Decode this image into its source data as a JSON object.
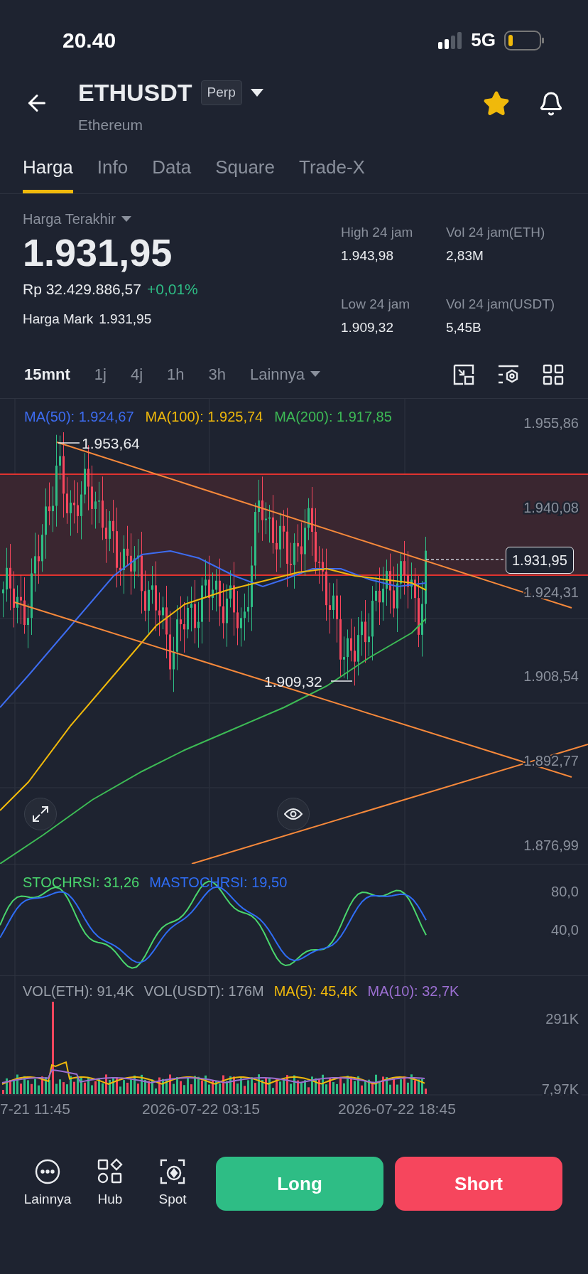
{
  "status_bar": {
    "time": "20.40",
    "network": "5G"
  },
  "header": {
    "symbol": "ETHUSDT",
    "badge": "Perp",
    "name": "Ethereum",
    "favorite": true
  },
  "tabs": [
    {
      "label": "Harga",
      "selected": true
    },
    {
      "label": "Info",
      "selected": false
    },
    {
      "label": "Data",
      "selected": false
    },
    {
      "label": "Square",
      "selected": false
    },
    {
      "label": "Trade-X",
      "selected": false
    }
  ],
  "stats": {
    "last_label": "Harga Terakhir",
    "price": "1.931,95",
    "fiat": "Rp 32.429.886,57",
    "change": "+0,01%",
    "mark_label": "Harga Mark",
    "mark_value": "1.931,95",
    "items": [
      {
        "label": "High 24 jam",
        "value": "1.943,98"
      },
      {
        "label": "Vol 24 jam(ETH)",
        "value": "2,83M"
      },
      {
        "label": "Low 24 jam",
        "value": "1.909,32"
      },
      {
        "label": "Vol 24 jam(USDT)",
        "value": "5,45B"
      }
    ]
  },
  "intervals": [
    {
      "label": "15mnt",
      "selected": true
    },
    {
      "label": "1j",
      "selected": false
    },
    {
      "label": "4j",
      "selected": false
    },
    {
      "label": "1h",
      "selected": false
    },
    {
      "label": "3h",
      "selected": false
    }
  ],
  "more_label": "Lainnya",
  "chart": {
    "legend": [
      {
        "label": "MA(50): 1.924,67",
        "color": "#3d6cf0"
      },
      {
        "label": "MA(100): 1.925,74",
        "color": "#f0b90b"
      },
      {
        "label": "MA(200): 1.917,85",
        "color": "#3dbb55"
      }
    ],
    "price_axis": [
      "1.955,86",
      "1.940,08",
      "1.924,31",
      "1.908,54",
      "1.892,77",
      "1.876,99"
    ],
    "high_marker": "1.953,64",
    "low_marker": "1.909,32",
    "current_price": "1.931,95"
  },
  "stoch": {
    "legend": [
      {
        "label": "STOCHRSI: 31,26",
        "color": "#4ad66d"
      },
      {
        "label": "MASTOCHRSI: 19,50",
        "color": "#2f6df5"
      }
    ],
    "axis": [
      "80,0",
      "40,0"
    ]
  },
  "volume": {
    "legend": [
      {
        "label": "VOL(ETH): 91,4K",
        "color": "#9aa0aa"
      },
      {
        "label": "VOL(USDT): 176M",
        "color": "#9aa0aa"
      },
      {
        "label": "MA(5): 45,4K",
        "color": "#f0b90b"
      },
      {
        "label": "MA(10): 32,7K",
        "color": "#9b6fd1"
      }
    ],
    "axis": [
      "291K",
      "7,97K"
    ]
  },
  "time_axis": [
    "7-21 11:45",
    "2026-07-22 03:15",
    "2026-07-22 18:45"
  ],
  "bottom_nav": [
    {
      "label": "Lainnya"
    },
    {
      "label": "Hub"
    },
    {
      "label": "Spot"
    }
  ],
  "buttons": [
    {
      "label": "Long",
      "kind": "long"
    },
    {
      "label": "Short",
      "kind": "short"
    }
  ]
}
